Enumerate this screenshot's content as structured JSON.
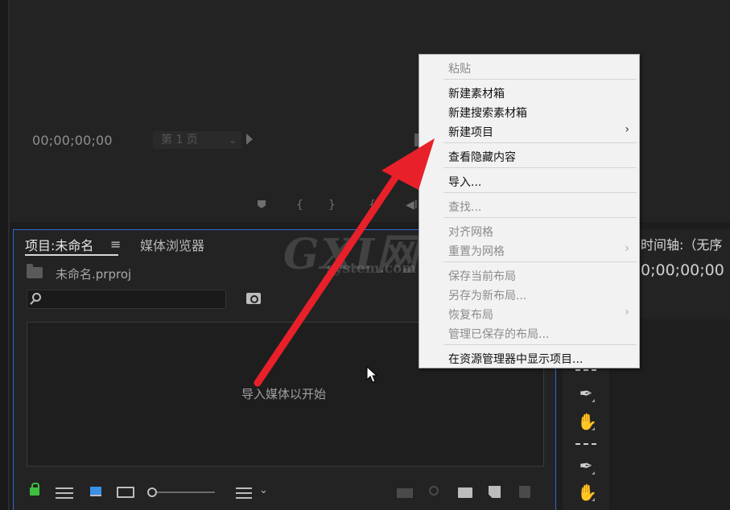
{
  "monitor": {
    "timecode": "00;00;00;00",
    "page_select": "第 1 页",
    "transport_glyphs": [
      "{",
      "}",
      "{",
      "◀I"
    ]
  },
  "project_panel": {
    "tab_project": "项目:未命名",
    "tab_media_browser": "媒体浏览器",
    "file_name": "未命名.prproj",
    "search_placeholder": "",
    "drop_hint": "导入媒体以开始"
  },
  "timeline": {
    "title": "时间轴:（无序",
    "timecode": "0;00;00;00"
  },
  "context_menu": {
    "items": [
      {
        "label": "粘贴",
        "enabled": false,
        "submenu": false
      },
      {
        "label": "新建素材箱",
        "enabled": true,
        "submenu": false
      },
      {
        "label": "新建搜索素材箱",
        "enabled": true,
        "submenu": false
      },
      {
        "label": "新建项目",
        "enabled": true,
        "submenu": true
      },
      {
        "label": "查看隐藏内容",
        "enabled": true,
        "submenu": false
      },
      {
        "label": "导入...",
        "enabled": true,
        "submenu": false
      },
      {
        "label": "查找...",
        "enabled": false,
        "submenu": false
      },
      {
        "label": "对齐网格",
        "enabled": false,
        "submenu": false
      },
      {
        "label": "重置为网格",
        "enabled": false,
        "submenu": true
      },
      {
        "label": "保存当前布局",
        "enabled": false,
        "submenu": false
      },
      {
        "label": "另存为新布局...",
        "enabled": false,
        "submenu": false
      },
      {
        "label": "恢复布局",
        "enabled": false,
        "submenu": true
      },
      {
        "label": "管理已保存的布局...",
        "enabled": false,
        "submenu": false
      },
      {
        "label": "在资源管理器中显示项目...",
        "enabled": true,
        "submenu": false
      }
    ],
    "submenu_glyph": "›"
  },
  "watermark": {
    "logo": "GXI网",
    "domain": "system.com"
  },
  "icons": {
    "pen": "✒",
    "hand": "✋",
    "menu": "≡",
    "chevron": "⌄"
  },
  "colors": {
    "accent_border": "#2e6bd0",
    "annotation_arrow": "#e8202a",
    "lock_green": "#3fbf3f",
    "icon_view_blue": "#3a8fe8"
  }
}
